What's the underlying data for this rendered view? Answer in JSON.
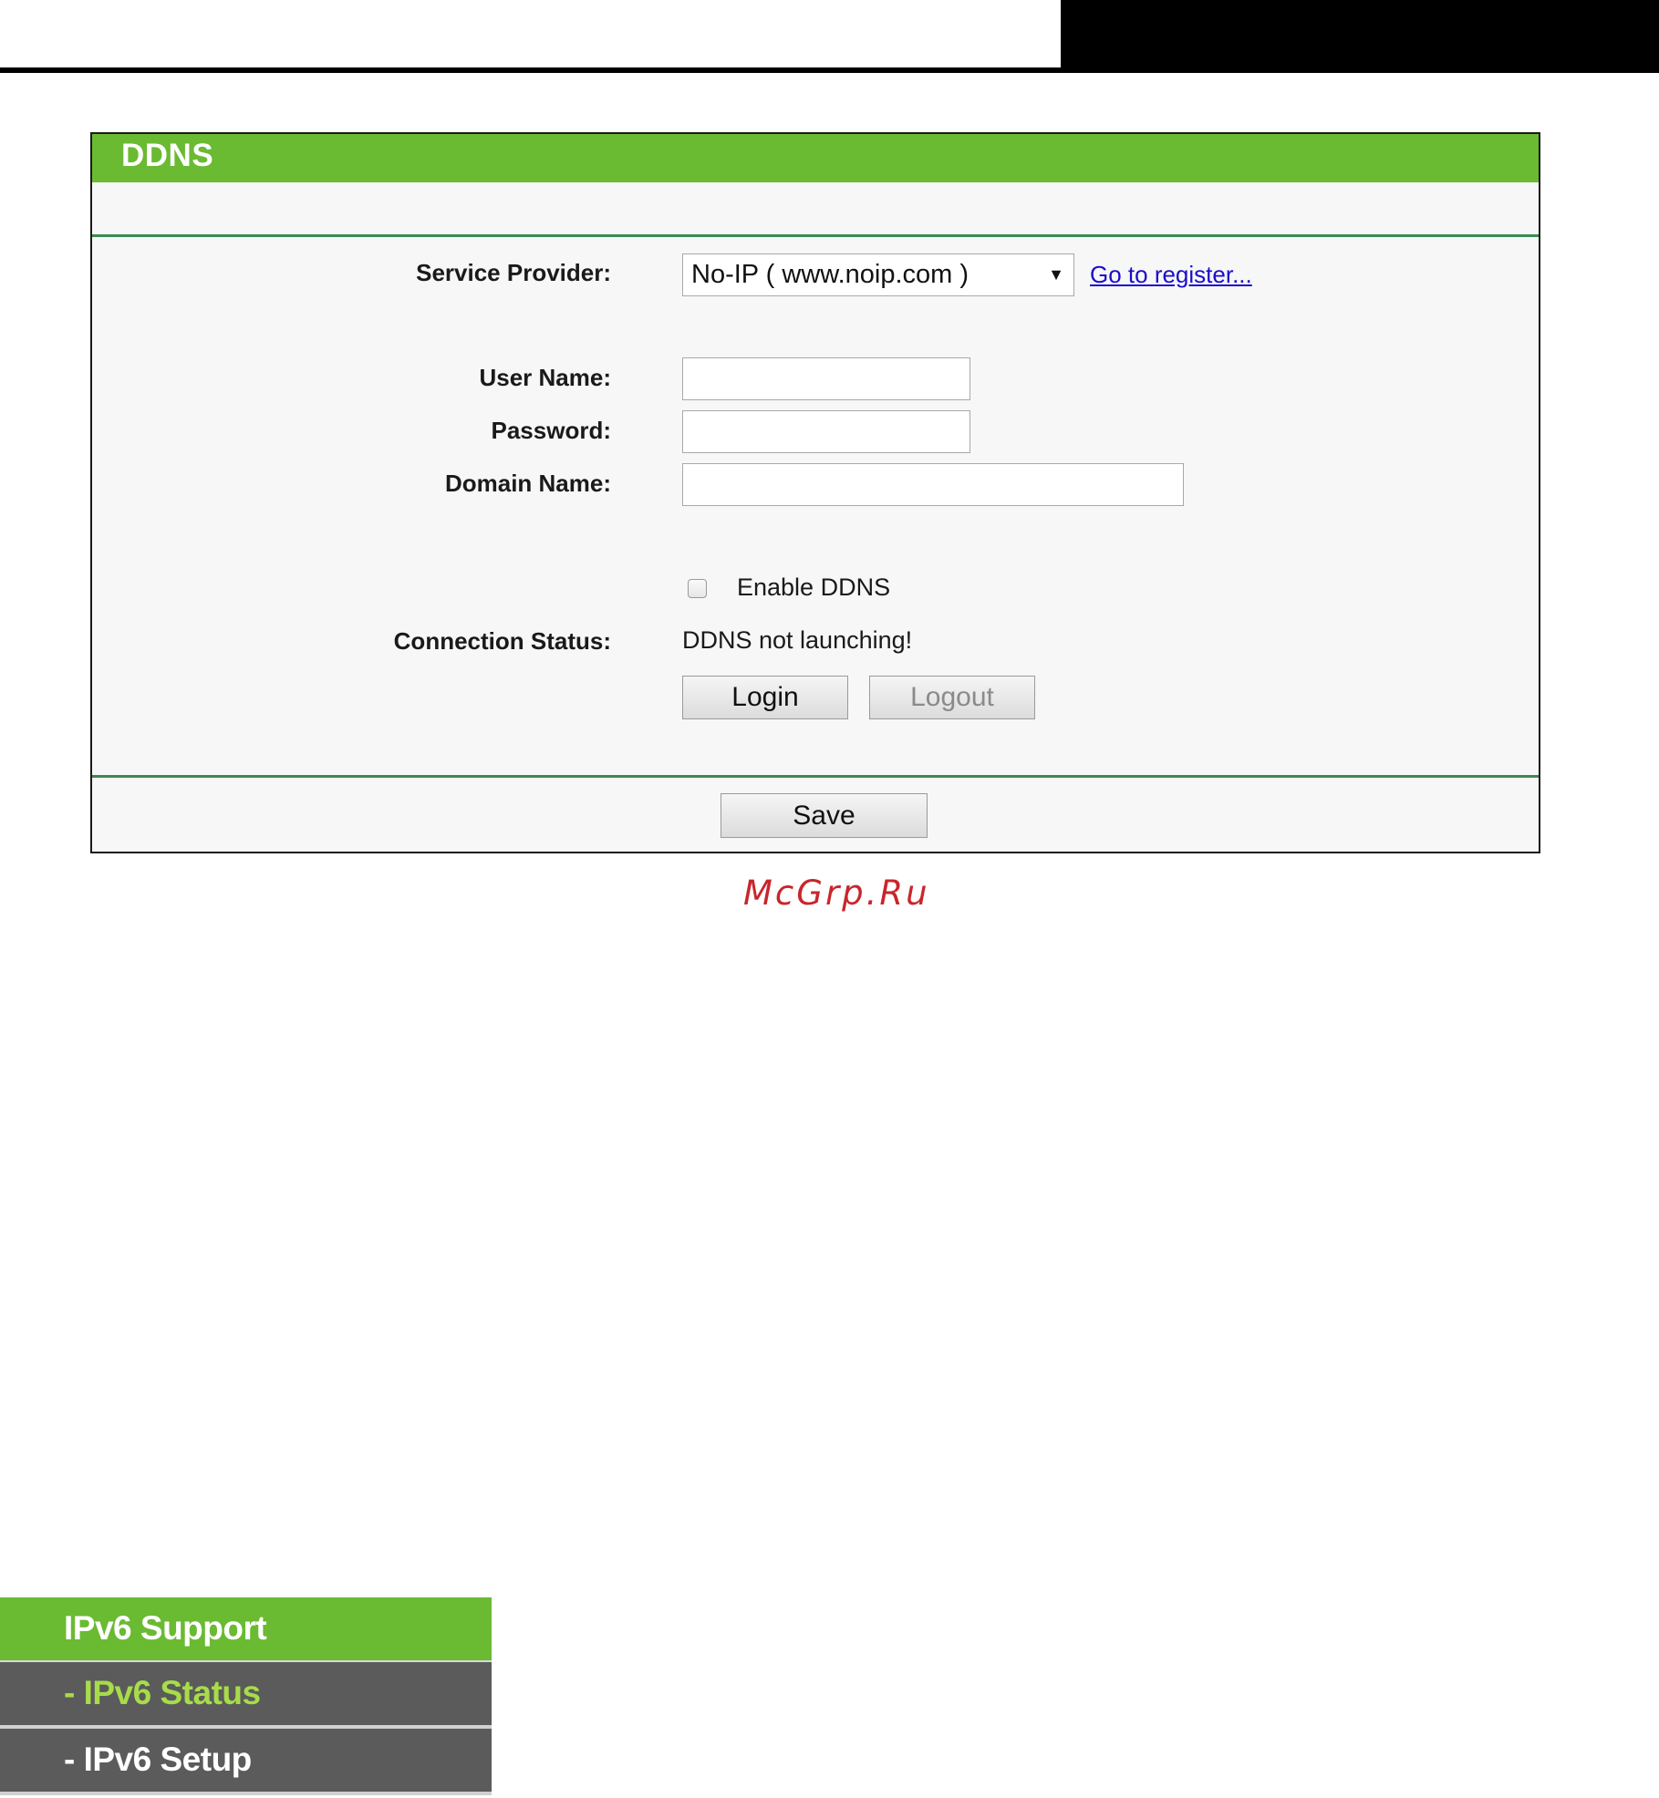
{
  "panel": {
    "title": "DDNS",
    "service_provider_label": "Service Provider:",
    "service_provider_selected": "No-IP ( www.noip.com )",
    "register_link": "Go to register...",
    "user_name_label": "User Name:",
    "user_name_value": "",
    "password_label": "Password:",
    "password_value": "",
    "domain_name_label": "Domain Name:",
    "domain_name_value": "",
    "enable_ddns_label": "Enable DDNS",
    "enable_ddns_checked": false,
    "connection_status_label": "Connection Status:",
    "connection_status_value": "DDNS not launching!",
    "login_label": "Login",
    "logout_label": "Logout",
    "save_label": "Save"
  },
  "watermark": "McGrp.Ru",
  "menu": {
    "items": [
      {
        "label": "IPv6 Support"
      },
      {
        "label": "- IPv6 Status"
      },
      {
        "label": "- IPv6 Setup"
      }
    ]
  },
  "colors": {
    "header_green": "#6aba32",
    "divider_green": "#3a8a52",
    "link_blue": "#1a0dcc",
    "menu_gray": "#5b5b5b",
    "menu_active_text": "#a7dc4a",
    "watermark_red": "#c8262c"
  },
  "icons": {
    "select_arrow": "dropdown-triangle-icon"
  }
}
